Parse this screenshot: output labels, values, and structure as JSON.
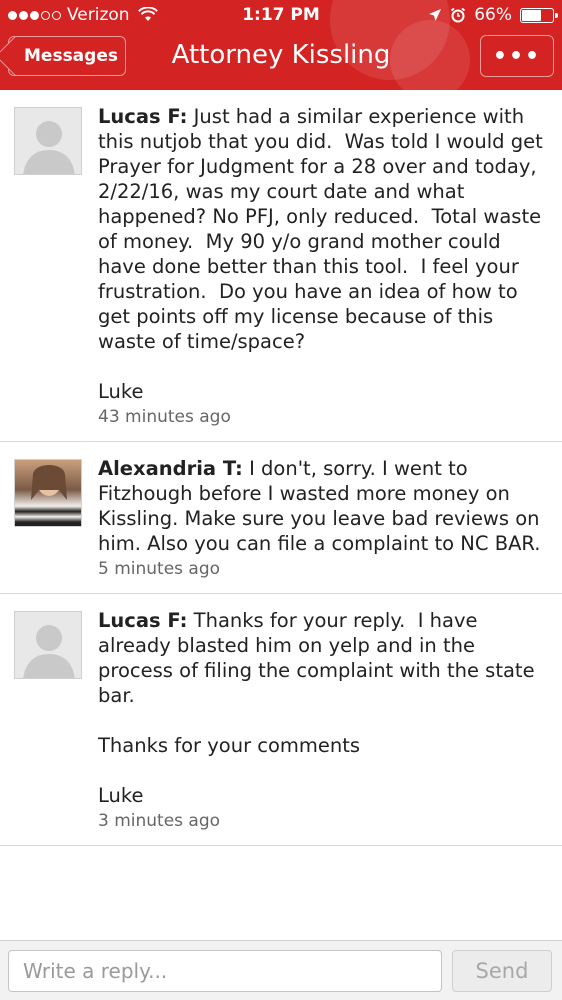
{
  "status_bar": {
    "carrier": "Verizon",
    "signal_bars": 3,
    "signal_total": 5,
    "time": "1:17 PM",
    "battery": "66%",
    "battery_level": 0.66
  },
  "nav": {
    "back_label": "Messages",
    "title": "Attorney Kissling",
    "more_label": "•••"
  },
  "messages": [
    {
      "author": "Lucas F:",
      "avatar": "default-avatar",
      "text": " Just had a similar experience with this nutjob that you did.  Was told I would get Prayer for Judgment for a 28 over and today, 2/22/16, was my court date and what happened? No PFJ, only reduced.  Total waste of money.  My 90 y/o grand mother could have done better than this tool.  I feel your frustration.  Do you have an idea of how to get points off my license because of this waste of time/space?\n\nLuke",
      "time": "43 minutes ago"
    },
    {
      "author": "Alexandria T:",
      "avatar": "user-photo",
      "text": " I don't, sorry. I went to Fitzhough before I wasted more money on Kissling. Make sure you leave bad reviews on him. Also you can file a complaint to NC BAR.",
      "time": "5 minutes ago"
    },
    {
      "author": "Lucas F:",
      "avatar": "default-avatar",
      "text": " Thanks for your reply.  I have already blasted him on yelp and in the process of filing the complaint with the state bar.\n\nThanks for your comments\n\nLuke",
      "time": "3 minutes ago"
    }
  ],
  "reply": {
    "placeholder": "Write a reply...",
    "value": "",
    "send_label": "Send"
  },
  "colors": {
    "brand_red": "#d32323"
  }
}
